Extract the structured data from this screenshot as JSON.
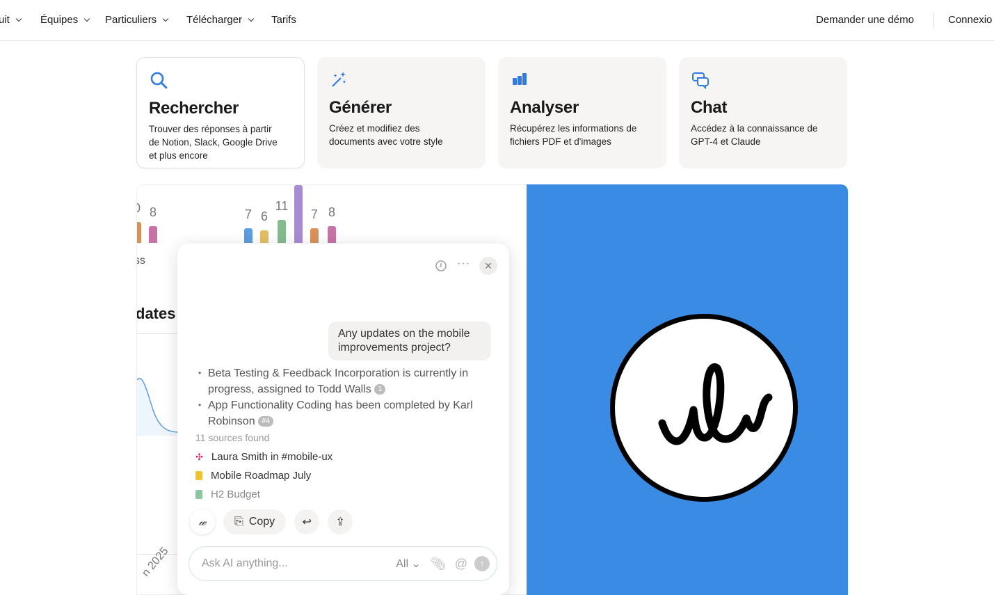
{
  "nav": {
    "left": [
      {
        "label": "uit",
        "dropdown": true
      },
      {
        "label": "Équipes",
        "dropdown": true
      },
      {
        "label": "Particuliers",
        "dropdown": true
      },
      {
        "label": "Télécharger",
        "dropdown": true
      },
      {
        "label": "Tarifs",
        "dropdown": false
      }
    ],
    "demo": "Demander une démo",
    "login": "Connexio"
  },
  "cards": [
    {
      "icon": "search-icon",
      "title": "Rechercher",
      "desc": "Trouver des réponses à partir de Notion, Slack, Google Drive et plus encore",
      "active": true
    },
    {
      "icon": "sparkles-icon",
      "title": "Générer",
      "desc": "Créez et modifiez des documents avec votre style",
      "active": false
    },
    {
      "icon": "bar-chart-icon",
      "title": "Analyser",
      "desc": "Récupérez les informations de fichiers PDF et d'images",
      "active": false
    },
    {
      "icon": "chat-icon",
      "title": "Chat",
      "desc": "Accédez à la connaissance de GPT-4 et Claude",
      "active": false
    }
  ],
  "background": {
    "bars": [
      {
        "label": "0",
        "value": 10,
        "color": "#d9915a"
      },
      {
        "label": "8",
        "value": 8,
        "color": "#c873a6"
      },
      {
        "label": "7",
        "value": 7,
        "color": "#5b9de0"
      },
      {
        "label": "6",
        "value": 6,
        "color": "#e3be60"
      },
      {
        "label": "11",
        "value": 11,
        "color": "#84bb8f"
      },
      {
        "label": "",
        "value": 30,
        "color": "#a88bd6"
      },
      {
        "label": "7",
        "value": 7,
        "color": "#d9915a"
      },
      {
        "label": "8",
        "value": 8,
        "color": "#c873a6"
      }
    ],
    "fragment1": "ss",
    "fragment2": "dates",
    "fragment3": "n 2025"
  },
  "chat": {
    "question": "Any updates on the mobile improvements project?",
    "answer": [
      {
        "text": "Beta Testing & Feedback Incorporation is currently in progress, assigned to Todd Walls",
        "cite": "1"
      },
      {
        "text": "App Functionality Coding has been completed by Karl Robinson",
        "cite": "#4"
      }
    ],
    "sources_label": "11 sources found",
    "sources": [
      {
        "icon": "slack-icon",
        "label": "Laura Smith in #mobile-ux"
      },
      {
        "icon": "doc-icon",
        "label": "Mobile Roadmap July"
      },
      {
        "icon": "sheet-icon",
        "label": "H2 Budget"
      }
    ],
    "copy": "Copy",
    "placeholder": "Ask AI anything...",
    "scope": "All"
  },
  "colors": {
    "accent": "#3a8be3",
    "icon_blue": "#2f7ae5"
  }
}
